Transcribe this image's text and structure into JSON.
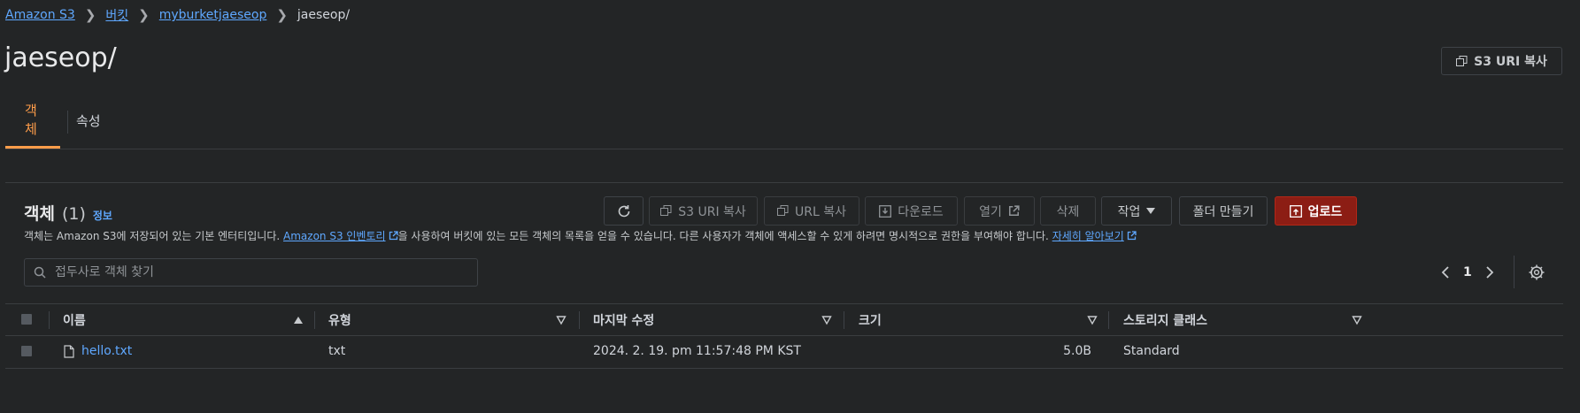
{
  "breadcrumb": [
    "Amazon S3",
    "버킷",
    "myburketjaeseop",
    "jaeseop/"
  ],
  "title": "jaeseop/",
  "copy_uri_label": "S3 URI 복사",
  "tabs": [
    {
      "label": "객체"
    },
    {
      "label": "속성"
    }
  ],
  "objects": {
    "title": "객체",
    "count": "(1)",
    "info": "정보",
    "desc_before": "객체는 Amazon S3에 저장되어 있는 기본 엔터티입니다.",
    "desc_link": "Amazon S3 인벤토리",
    "desc_middle": "을 사용하여 버킷에 있는 모든 객체의 목록을 얻을 수 있습니다. 다른 사용자가 객체에 액세스할 수 있게 하려면 명시적으로 권한을 부여해야 합니다.",
    "desc_learn": "자세히 알아보기"
  },
  "toolbar": {
    "copy_s3_uri": "S3 URI 복사",
    "copy_url": "URL 복사",
    "download": "다운로드",
    "open": "열기",
    "delete": "삭제",
    "actions": "작업",
    "create_folder": "폴더 만들기",
    "upload": "업로드"
  },
  "search": {
    "placeholder": "접두사로 객체 찾기"
  },
  "pagination": {
    "page": "1"
  },
  "table": {
    "columns": [
      "이름",
      "유형",
      "마지막 수정",
      "크기",
      "스토리지 클래스"
    ],
    "rows": [
      {
        "name": "hello.txt",
        "type": "txt",
        "modified": "2024. 2. 19. pm 11:57:48 PM KST",
        "size": "5.0B",
        "storage": "Standard"
      }
    ]
  },
  "colors": {
    "background": "#232526",
    "accent_tab": "#ff9d4a",
    "link": "#5fa8ff",
    "upload_bg": "#8c1d14"
  }
}
